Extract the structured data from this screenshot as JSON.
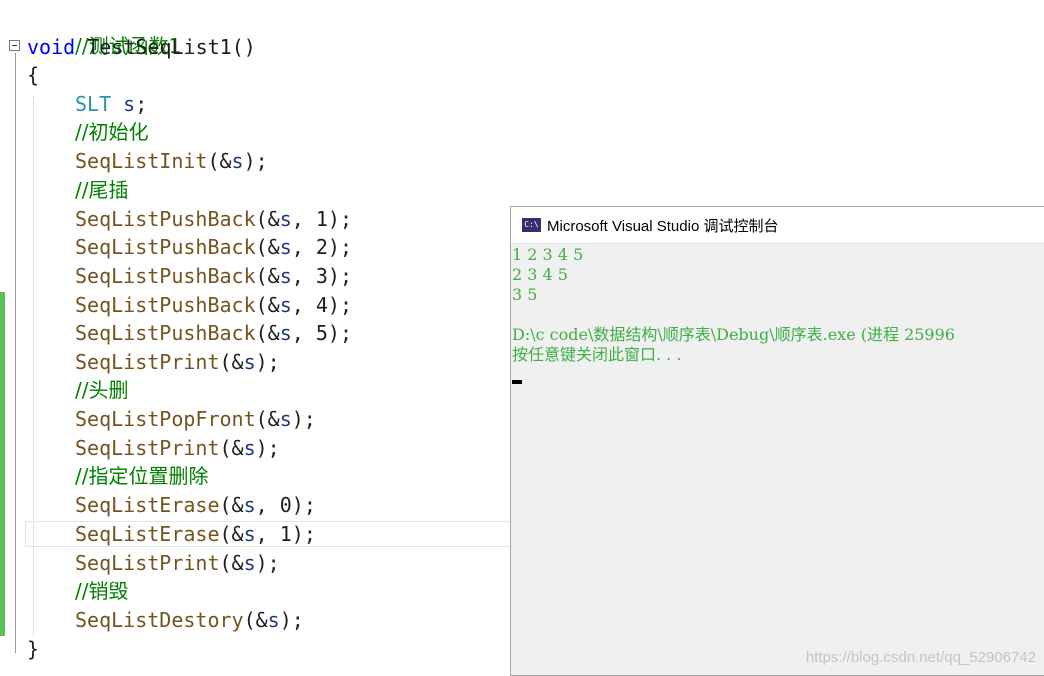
{
  "editor": {
    "lines": [
      {
        "comment": "//测试函数1"
      },
      {
        "kw": "void",
        "name": "TestSeqList1",
        "punct": "()"
      },
      {
        "punct": "{"
      },
      {
        "type": "SLT",
        "var": "s",
        "punct": ";"
      },
      {
        "comment": "//初始化"
      },
      {
        "fn": "SeqListInit",
        "open": "(&",
        "var": "s",
        "close": ");"
      },
      {
        "comment": "//尾插"
      },
      {
        "fn": "SeqListPushBack",
        "open": "(&",
        "var": "s",
        "mid": ", ",
        "num": "1",
        "close": ");"
      },
      {
        "fn": "SeqListPushBack",
        "open": "(&",
        "var": "s",
        "mid": ", ",
        "num": "2",
        "close": ");"
      },
      {
        "fn": "SeqListPushBack",
        "open": "(&",
        "var": "s",
        "mid": ", ",
        "num": "3",
        "close": ");"
      },
      {
        "fn": "SeqListPushBack",
        "open": "(&",
        "var": "s",
        "mid": ", ",
        "num": "4",
        "close": ");"
      },
      {
        "fn": "SeqListPushBack",
        "open": "(&",
        "var": "s",
        "mid": ", ",
        "num": "5",
        "close": ");"
      },
      {
        "fn": "SeqListPrint",
        "open": "(&",
        "var": "s",
        "close": ");"
      },
      {
        "comment": "//头删"
      },
      {
        "fn": "SeqListPopFront",
        "open": "(&",
        "var": "s",
        "close": ");"
      },
      {
        "fn": "SeqListPrint",
        "open": "(&",
        "var": "s",
        "close": ");"
      },
      {
        "comment": "//指定位置删除"
      },
      {
        "fn": "SeqListErase",
        "open": "(&",
        "var": "s",
        "mid": ", ",
        "num": "0",
        "close": ");"
      },
      {
        "fn": "SeqListErase",
        "open": "(&",
        "var": "s",
        "mid": ", ",
        "num": "1",
        "close": ");"
      },
      {
        "fn": "SeqListPrint",
        "open": "(&",
        "var": "s",
        "close": ");"
      },
      {
        "comment": "//销毁"
      },
      {
        "fn": "SeqListDestory",
        "open": "(&",
        "var": "s",
        "close": ");"
      },
      {
        "punct": "}"
      }
    ]
  },
  "console": {
    "icon_text": "C:\\",
    "title": "Microsoft Visual Studio 调试控制台",
    "output": [
      "1 2 3 4 5",
      "2 3 4 5",
      "3 5",
      "",
      "D:\\c code\\数据结构\\顺序表\\Debug\\顺序表.exe (进程 25996",
      "按任意键关闭此窗口. . ."
    ]
  },
  "watermark": "https://blog.csdn.net/qq_52906742",
  "colors": {
    "comment": "#008000",
    "keyword": "#0000ff",
    "function": "#74531f",
    "type": "#2b91af",
    "variable": "#1f377f",
    "console_text": "#3cb043",
    "change_bar": "#57c253"
  }
}
